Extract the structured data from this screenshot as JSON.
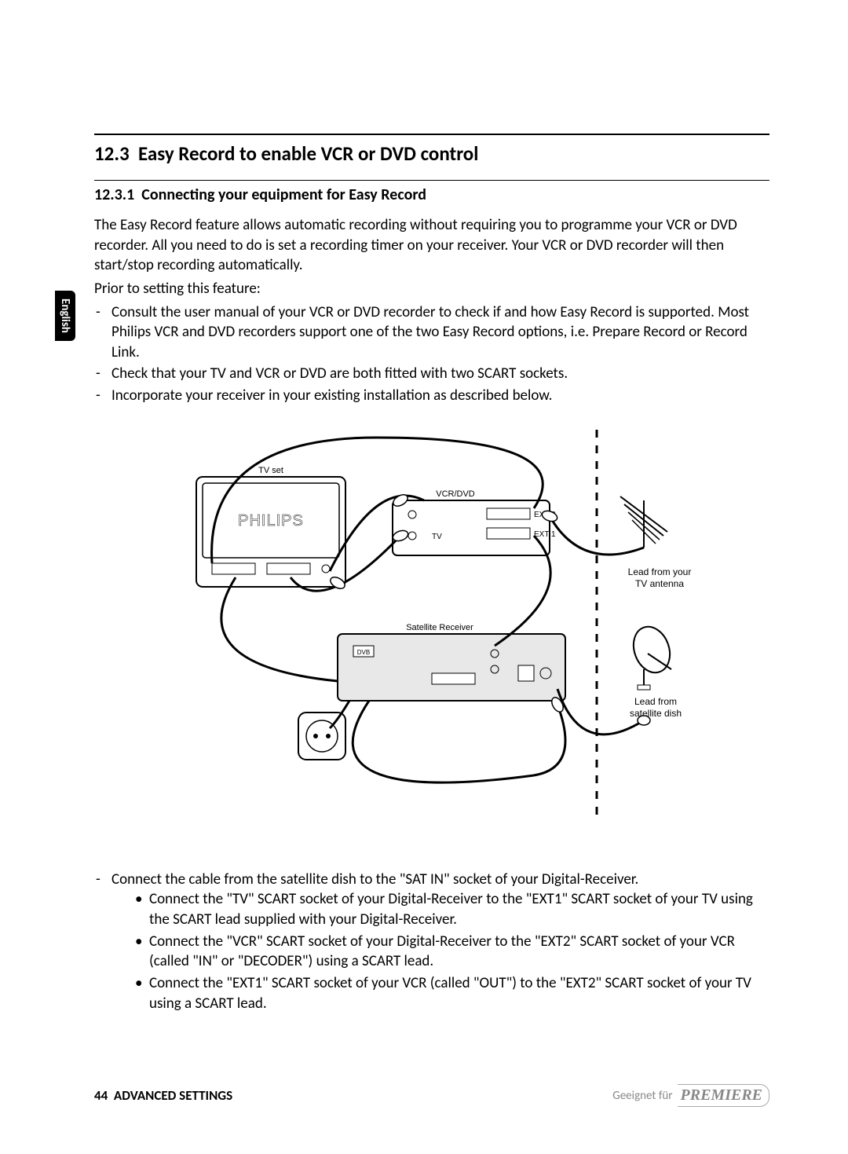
{
  "sideTab": "English",
  "sectionNumber": "12.3",
  "sectionTitle": "Easy Record to enable VCR or DVD control",
  "subNumber": "12.3.1",
  "subTitle": "Connecting your equipment for Easy Record",
  "intro1": "The Easy Record feature allows automatic recording without requiring you to programme your VCR or DVD recorder. All you need to do is set a recording timer on your receiver. Your VCR or DVD recorder will then start/stop recording automatically.",
  "intro2": "Prior to setting this feature:",
  "preList": [
    "Consult the user manual of your VCR or DVD recorder to check if and how Easy Record is supported. Most Philips VCR and DVD recorders support one of the two Easy Record options, i.e. Prepare Record or Record Link.",
    "Check that your TV and VCR or DVD are both fitted with two SCART sockets.",
    "Incorporate your receiver in your existing installation as described below."
  ],
  "diagram": {
    "tvSet": "TV set",
    "philips": "PHILIPS",
    "vcrDvd": "VCR/DVD",
    "tv": "TV",
    "ext1": "EXT 1",
    "ext2": "EXT 2",
    "satReceiver": "Satellite Receiver",
    "dvb": "DVB",
    "leadAntenna1": "Lead from your",
    "leadAntenna2": "TV antenna",
    "leadDish1": "Lead from",
    "leadDish2": "satellite dish"
  },
  "postDash": "Connect the cable from the satellite dish to the \"SAT IN\" socket of your Digital-Receiver.",
  "postBullets": [
    "Connect the \"TV\" SCART socket of your Digital-Receiver to the \"EXT1\" SCART socket of your TV using the SCART lead supplied with your Digital-Receiver.",
    "Connect the \"VCR\" SCART socket of your Digital-Receiver to the \"EXT2\" SCART socket of your VCR (called \"IN\" or \"DECODER\") using a SCART lead.",
    "Connect the \"EXT1\" SCART socket of your VCR (called \"OUT\") to the \"EXT2\" SCART socket of your TV using a SCART lead."
  ],
  "pageNum": "44",
  "footerTitle": "ADVANCED SETTINGS",
  "footerRight": "Geeignet für",
  "premiere": "PREMIERE"
}
